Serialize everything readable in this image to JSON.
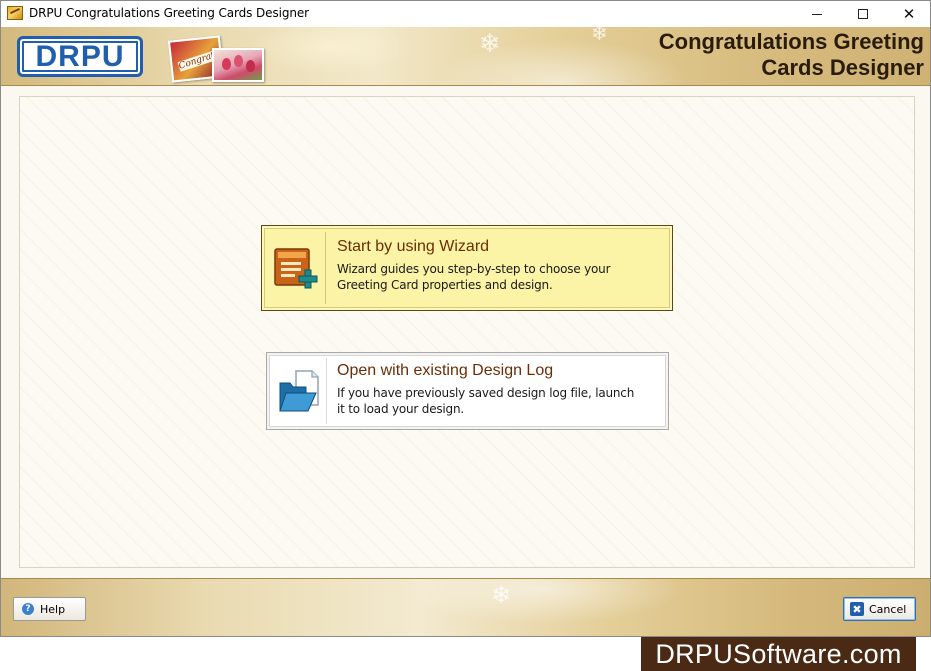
{
  "window": {
    "title": "DRPU Congratulations Greeting Cards Designer",
    "minimize_icon": "minimize-icon",
    "maximize_icon": "maximize-icon",
    "close_icon": "close-icon",
    "close_glyph": "✕"
  },
  "header": {
    "logo_text": "DRPU",
    "card_label": "Congrats",
    "product_title_line1": "Congratulations Greeting",
    "product_title_line2": "Cards Designer"
  },
  "options": [
    {
      "title": "Start by using Wizard",
      "description_line1": "Wizard guides you step-by-step to choose your",
      "description_line2": "Greeting Card properties and design.",
      "icon": "wizard-icon",
      "selected": true
    },
    {
      "title": "Open with existing Design Log",
      "description_line1": "If you have previously saved design log file, launch",
      "description_line2": "it to load your design.",
      "icon": "open-folder-icon",
      "selected": false
    }
  ],
  "footer": {
    "help_label": "Help",
    "help_glyph": "?",
    "cancel_label": "Cancel",
    "cancel_glyph": "✖"
  },
  "watermark": "DRPUSoftware.com",
  "colors": {
    "accent_blue": "#1f5fae",
    "option_title": "#6b2e06",
    "wizard_highlight": "#fbf3a6",
    "watermark_bg": "#4a2a14"
  }
}
